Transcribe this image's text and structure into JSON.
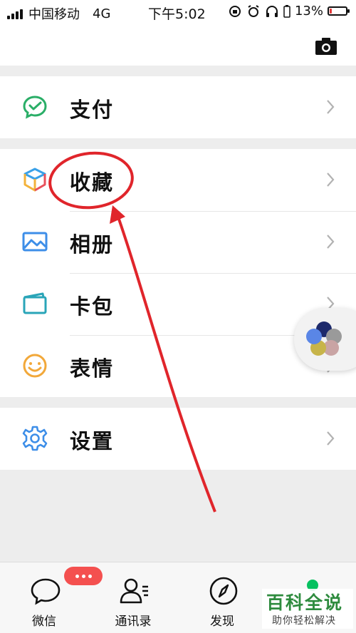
{
  "status_bar": {
    "carrier": "中国移动",
    "network": "4G",
    "time": "下午5:02",
    "battery_percent_text": "13%",
    "battery_level": 0.13,
    "battery_color": "#e23a3a"
  },
  "header": {
    "camera_icon": "camera-icon"
  },
  "menu_groups": [
    {
      "items": [
        {
          "label": "支付",
          "icon": "wechat-pay-icon"
        }
      ]
    },
    {
      "items": [
        {
          "label": "收藏",
          "icon": "favorites-cube-icon"
        },
        {
          "label": "相册",
          "icon": "album-icon"
        },
        {
          "label": "卡包",
          "icon": "card-wallet-icon"
        },
        {
          "label": "表情",
          "icon": "sticker-smile-icon"
        }
      ]
    },
    {
      "items": [
        {
          "label": "设置",
          "icon": "settings-gear-icon"
        }
      ]
    }
  ],
  "tabbar": {
    "tabs": [
      {
        "label": "微信",
        "icon": "chat-bubble-icon"
      },
      {
        "label": "通讯录",
        "icon": "contacts-icon"
      },
      {
        "label": "发现",
        "icon": "compass-icon"
      },
      {
        "label": "",
        "icon": "me-icon"
      }
    ],
    "badge_dots": "···",
    "accent_color": "#07c160"
  },
  "watermark": {
    "title": "百科全说",
    "subtitle": "助你轻松解决"
  },
  "colors": {
    "annotation_red": "#e0252b",
    "wechat_green": "#07c160",
    "badge_red": "#f4504f"
  }
}
